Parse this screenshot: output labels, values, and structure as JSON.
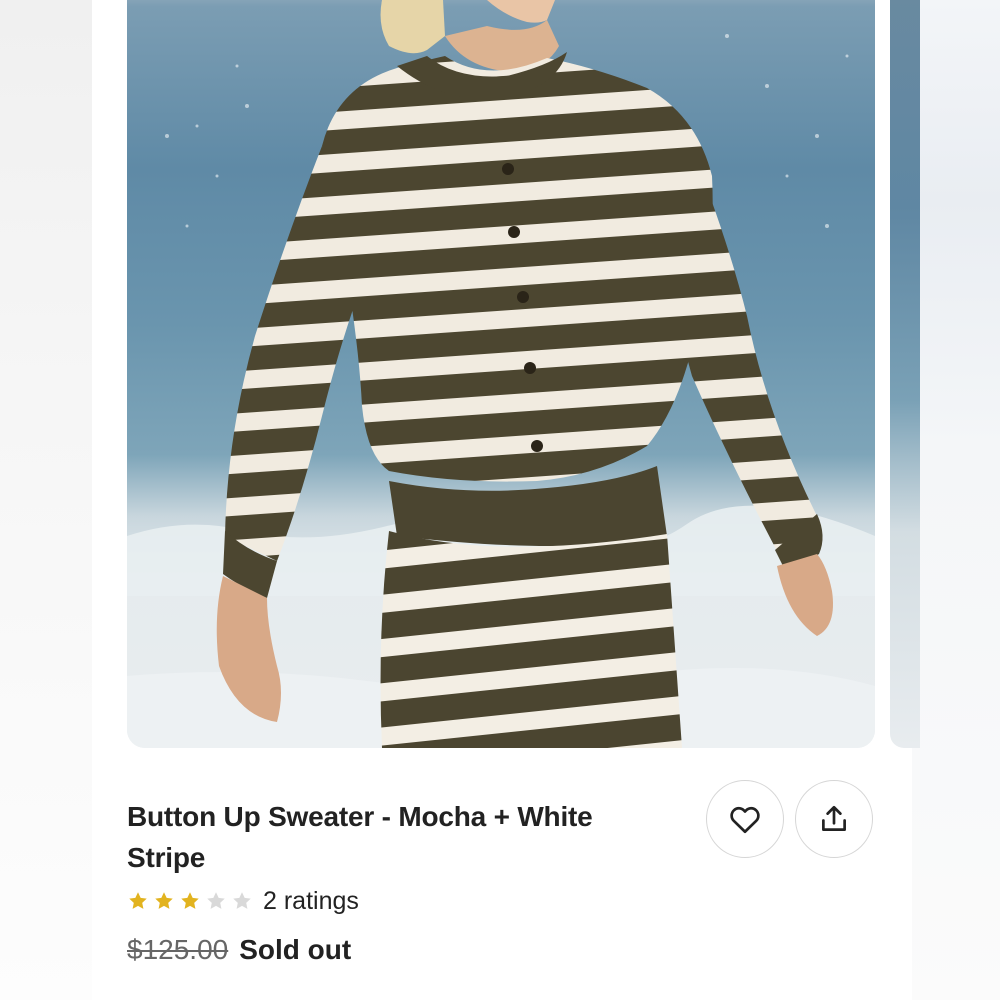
{
  "product": {
    "image_alt": "Woman on a beach wearing a mocha and white striped button up sweater and matching striped pants",
    "title": "Button Up Sweater - Mocha + White Stripe",
    "rating": 3,
    "rating_max": 5,
    "ratings_label": "2 ratings",
    "original_price": "$125.00",
    "availability": "Sold out"
  },
  "actions": {
    "favorite_icon": "heart-icon",
    "share_icon": "share-icon"
  },
  "colors": {
    "star_filled": "#e2b31f",
    "star_empty": "#d9d9d9",
    "text_primary": "#222222",
    "text_muted": "#666666",
    "border": "#d6d6d6",
    "sweater_dark": "#4c4630",
    "sweater_light": "#f1ebe0"
  }
}
